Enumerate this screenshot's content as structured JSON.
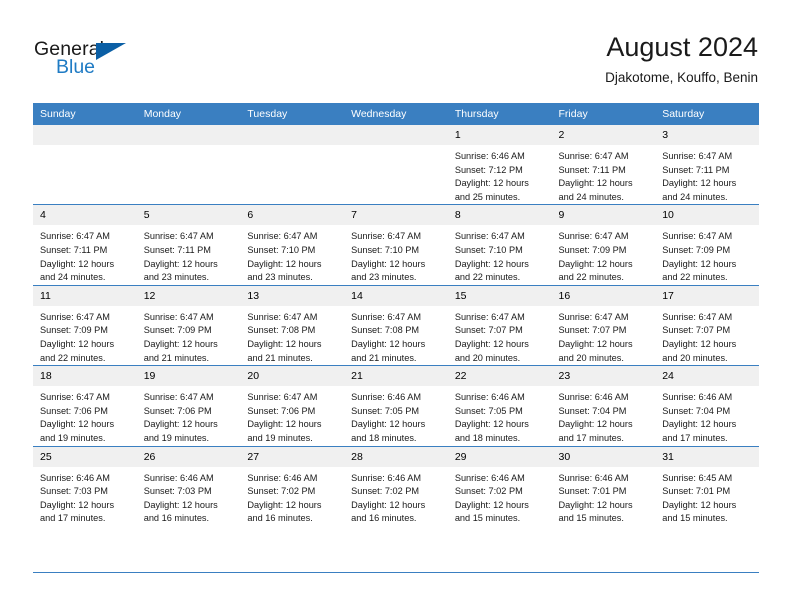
{
  "brand": {
    "name_part1": "General",
    "name_part2": "Blue",
    "icon": "triangle-logo-icon",
    "accent_color": "#1f7bc4",
    "triangle_color": "#0b5fa5"
  },
  "header": {
    "title": "August 2024",
    "subtitle": "Djakotome, Kouffo, Benin"
  },
  "theme": {
    "header_bg": "#3a7fc1",
    "daynum_bg": "#f0f0f0",
    "grid_line": "#3a7fc1"
  },
  "calendar": {
    "weekday_headers": [
      "Sunday",
      "Monday",
      "Tuesday",
      "Wednesday",
      "Thursday",
      "Friday",
      "Saturday"
    ],
    "weeks": [
      [
        {
          "day": "",
          "blank": true,
          "sunrise": "",
          "sunset": "",
          "daylight1": "",
          "daylight2": ""
        },
        {
          "day": "",
          "blank": true,
          "sunrise": "",
          "sunset": "",
          "daylight1": "",
          "daylight2": ""
        },
        {
          "day": "",
          "blank": true,
          "sunrise": "",
          "sunset": "",
          "daylight1": "",
          "daylight2": ""
        },
        {
          "day": "",
          "blank": true,
          "sunrise": "",
          "sunset": "",
          "daylight1": "",
          "daylight2": ""
        },
        {
          "day": "1",
          "sunrise": "Sunrise: 6:46 AM",
          "sunset": "Sunset: 7:12 PM",
          "daylight1": "Daylight: 12 hours",
          "daylight2": "and 25 minutes."
        },
        {
          "day": "2",
          "sunrise": "Sunrise: 6:47 AM",
          "sunset": "Sunset: 7:11 PM",
          "daylight1": "Daylight: 12 hours",
          "daylight2": "and 24 minutes."
        },
        {
          "day": "3",
          "sunrise": "Sunrise: 6:47 AM",
          "sunset": "Sunset: 7:11 PM",
          "daylight1": "Daylight: 12 hours",
          "daylight2": "and 24 minutes."
        }
      ],
      [
        {
          "day": "4",
          "sunrise": "Sunrise: 6:47 AM",
          "sunset": "Sunset: 7:11 PM",
          "daylight1": "Daylight: 12 hours",
          "daylight2": "and 24 minutes."
        },
        {
          "day": "5",
          "sunrise": "Sunrise: 6:47 AM",
          "sunset": "Sunset: 7:11 PM",
          "daylight1": "Daylight: 12 hours",
          "daylight2": "and 23 minutes."
        },
        {
          "day": "6",
          "sunrise": "Sunrise: 6:47 AM",
          "sunset": "Sunset: 7:10 PM",
          "daylight1": "Daylight: 12 hours",
          "daylight2": "and 23 minutes."
        },
        {
          "day": "7",
          "sunrise": "Sunrise: 6:47 AM",
          "sunset": "Sunset: 7:10 PM",
          "daylight1": "Daylight: 12 hours",
          "daylight2": "and 23 minutes."
        },
        {
          "day": "8",
          "sunrise": "Sunrise: 6:47 AM",
          "sunset": "Sunset: 7:10 PM",
          "daylight1": "Daylight: 12 hours",
          "daylight2": "and 22 minutes."
        },
        {
          "day": "9",
          "sunrise": "Sunrise: 6:47 AM",
          "sunset": "Sunset: 7:09 PM",
          "daylight1": "Daylight: 12 hours",
          "daylight2": "and 22 minutes."
        },
        {
          "day": "10",
          "sunrise": "Sunrise: 6:47 AM",
          "sunset": "Sunset: 7:09 PM",
          "daylight1": "Daylight: 12 hours",
          "daylight2": "and 22 minutes."
        }
      ],
      [
        {
          "day": "11",
          "sunrise": "Sunrise: 6:47 AM",
          "sunset": "Sunset: 7:09 PM",
          "daylight1": "Daylight: 12 hours",
          "daylight2": "and 22 minutes."
        },
        {
          "day": "12",
          "sunrise": "Sunrise: 6:47 AM",
          "sunset": "Sunset: 7:09 PM",
          "daylight1": "Daylight: 12 hours",
          "daylight2": "and 21 minutes."
        },
        {
          "day": "13",
          "sunrise": "Sunrise: 6:47 AM",
          "sunset": "Sunset: 7:08 PM",
          "daylight1": "Daylight: 12 hours",
          "daylight2": "and 21 minutes."
        },
        {
          "day": "14",
          "sunrise": "Sunrise: 6:47 AM",
          "sunset": "Sunset: 7:08 PM",
          "daylight1": "Daylight: 12 hours",
          "daylight2": "and 21 minutes."
        },
        {
          "day": "15",
          "sunrise": "Sunrise: 6:47 AM",
          "sunset": "Sunset: 7:07 PM",
          "daylight1": "Daylight: 12 hours",
          "daylight2": "and 20 minutes."
        },
        {
          "day": "16",
          "sunrise": "Sunrise: 6:47 AM",
          "sunset": "Sunset: 7:07 PM",
          "daylight1": "Daylight: 12 hours",
          "daylight2": "and 20 minutes."
        },
        {
          "day": "17",
          "sunrise": "Sunrise: 6:47 AM",
          "sunset": "Sunset: 7:07 PM",
          "daylight1": "Daylight: 12 hours",
          "daylight2": "and 20 minutes."
        }
      ],
      [
        {
          "day": "18",
          "sunrise": "Sunrise: 6:47 AM",
          "sunset": "Sunset: 7:06 PM",
          "daylight1": "Daylight: 12 hours",
          "daylight2": "and 19 minutes."
        },
        {
          "day": "19",
          "sunrise": "Sunrise: 6:47 AM",
          "sunset": "Sunset: 7:06 PM",
          "daylight1": "Daylight: 12 hours",
          "daylight2": "and 19 minutes."
        },
        {
          "day": "20",
          "sunrise": "Sunrise: 6:47 AM",
          "sunset": "Sunset: 7:06 PM",
          "daylight1": "Daylight: 12 hours",
          "daylight2": "and 19 minutes."
        },
        {
          "day": "21",
          "sunrise": "Sunrise: 6:46 AM",
          "sunset": "Sunset: 7:05 PM",
          "daylight1": "Daylight: 12 hours",
          "daylight2": "and 18 minutes."
        },
        {
          "day": "22",
          "sunrise": "Sunrise: 6:46 AM",
          "sunset": "Sunset: 7:05 PM",
          "daylight1": "Daylight: 12 hours",
          "daylight2": "and 18 minutes."
        },
        {
          "day": "23",
          "sunrise": "Sunrise: 6:46 AM",
          "sunset": "Sunset: 7:04 PM",
          "daylight1": "Daylight: 12 hours",
          "daylight2": "and 17 minutes."
        },
        {
          "day": "24",
          "sunrise": "Sunrise: 6:46 AM",
          "sunset": "Sunset: 7:04 PM",
          "daylight1": "Daylight: 12 hours",
          "daylight2": "and 17 minutes."
        }
      ],
      [
        {
          "day": "25",
          "sunrise": "Sunrise: 6:46 AM",
          "sunset": "Sunset: 7:03 PM",
          "daylight1": "Daylight: 12 hours",
          "daylight2": "and 17 minutes."
        },
        {
          "day": "26",
          "sunrise": "Sunrise: 6:46 AM",
          "sunset": "Sunset: 7:03 PM",
          "daylight1": "Daylight: 12 hours",
          "daylight2": "and 16 minutes."
        },
        {
          "day": "27",
          "sunrise": "Sunrise: 6:46 AM",
          "sunset": "Sunset: 7:02 PM",
          "daylight1": "Daylight: 12 hours",
          "daylight2": "and 16 minutes."
        },
        {
          "day": "28",
          "sunrise": "Sunrise: 6:46 AM",
          "sunset": "Sunset: 7:02 PM",
          "daylight1": "Daylight: 12 hours",
          "daylight2": "and 16 minutes."
        },
        {
          "day": "29",
          "sunrise": "Sunrise: 6:46 AM",
          "sunset": "Sunset: 7:02 PM",
          "daylight1": "Daylight: 12 hours",
          "daylight2": "and 15 minutes."
        },
        {
          "day": "30",
          "sunrise": "Sunrise: 6:46 AM",
          "sunset": "Sunset: 7:01 PM",
          "daylight1": "Daylight: 12 hours",
          "daylight2": "and 15 minutes."
        },
        {
          "day": "31",
          "sunrise": "Sunrise: 6:45 AM",
          "sunset": "Sunset: 7:01 PM",
          "daylight1": "Daylight: 12 hours",
          "daylight2": "and 15 minutes."
        }
      ]
    ]
  }
}
